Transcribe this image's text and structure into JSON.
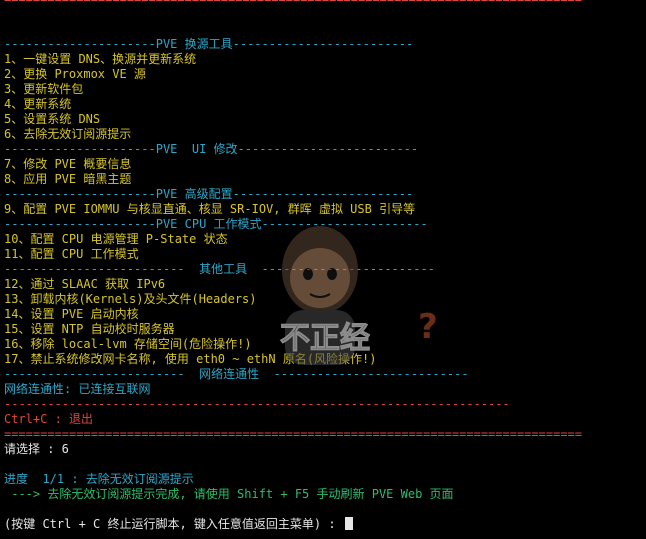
{
  "top_rule": "================================================================================",
  "section_mirror": "---------------------PVE 换源工具-------------------------",
  "menu_mirror": [
    "1、一键设置 DNS、换源并更新系统",
    "2、更换 Proxmox VE 源",
    "3、更新软件包",
    "4、更新系统",
    "5、设置系统 DNS",
    "6、去除无效订阅源提示"
  ],
  "section_ui": "---------------------PVE  UI 修改-------------------------",
  "menu_ui": [
    "7、修改 PVE 概要信息",
    "8、应用 PVE 暗黑主题"
  ],
  "section_adv": "---------------------PVE 高级配置-------------------------",
  "menu_adv": [
    "9、配置 PVE IOMMU 与核显直通、核显 SR-IOV, 群晖 虚拟 USB 引导等"
  ],
  "section_cpu": "---------------------PVE CPU 工作模式-----------------------",
  "menu_cpu": [
    "10、配置 CPU 电源管理 P-State 状态",
    "11、配置 CPU 工作模式"
  ],
  "section_other": "-------------------------  其他工具  ------------------------",
  "menu_other": [
    "12、通过 SLAAC 获取 IPv6",
    "13、卸载内核(Kernels)及头文件(Headers)",
    "14、设置 PVE 启动内核",
    "15、设置 NTP 自动校时服务器",
    "16、移除 local-lvm 存储空间(危险操作!)",
    "17、禁止系统修改网卡名称, 使用 eth0 ~ ethN 原名(风险操作!)"
  ],
  "section_net": "-------------------------  网络连通性  ---------------------------",
  "net_status": "网络连通性: 已连接互联网",
  "exit_rule": "----------------------------------------------------------------------",
  "exit_label": "Ctrl+C : 退出",
  "bottom_rule": "================================================================================",
  "prompt_choice": "请选择 : 6",
  "progress_line": "进度  1/1 : 去除无效订阅源提示",
  "result_line": " ---> 去除无效订阅源提示完成, 请使用 Shift + F5 手动刷新 PVE Web 页面",
  "final_prompt": "(按键 Ctrl + C 终止运行脚本, 键入任意值返回主菜单) : ",
  "watermark_text": "不正经",
  "colors": {
    "background": "#000000",
    "rule": "#e0443c",
    "header": "#2ea6c8",
    "menu": "#d6c52a",
    "text": "#e6e6e6",
    "success": "#2dbd6b"
  }
}
